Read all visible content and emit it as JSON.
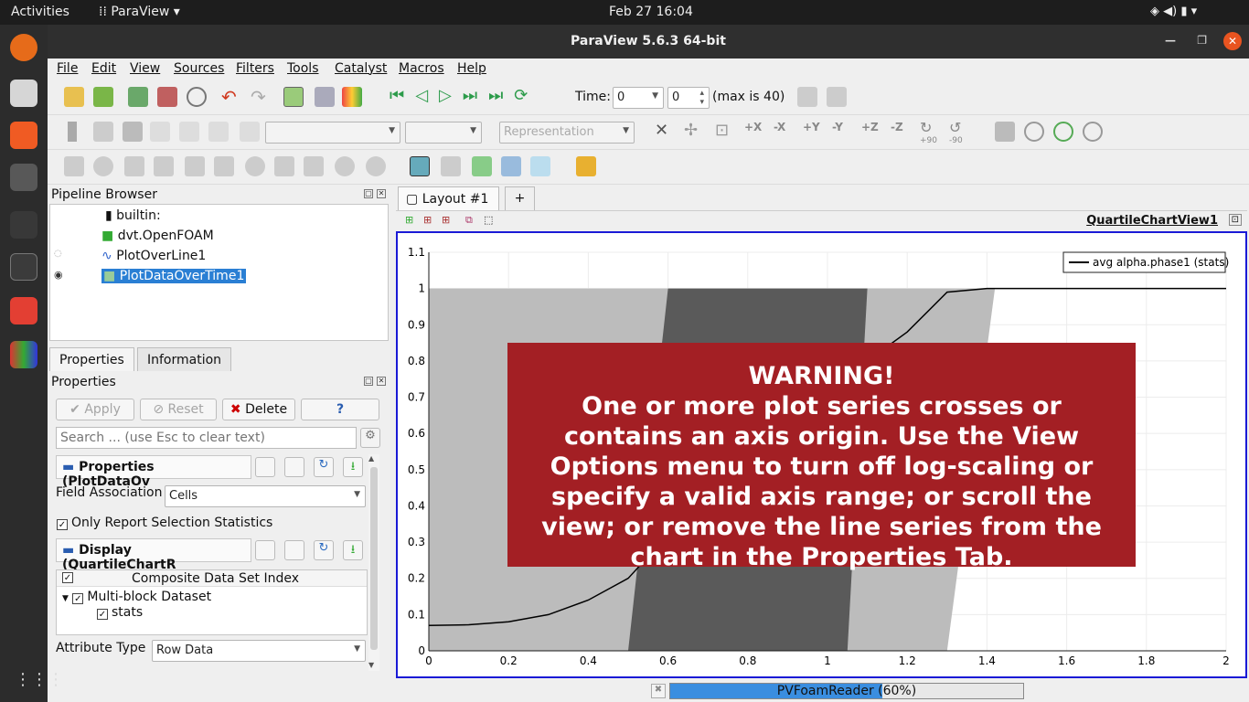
{
  "topbar": {
    "activities": "Activities",
    "app": "ParaView",
    "datetime": "Feb 27  16:04"
  },
  "window": {
    "title": "ParaView 5.6.3 64-bit"
  },
  "menu": [
    "File",
    "Edit",
    "View",
    "Sources",
    "Filters",
    "Tools",
    "Catalyst",
    "Macros",
    "Help"
  ],
  "time": {
    "label": "Time:",
    "value": "0",
    "step": "0",
    "max": "(max is 40)"
  },
  "repr_combo": {
    "placeholder": "Representation"
  },
  "view_buttons": {
    "px": "+X",
    "mx": "-X",
    "py": "+Y",
    "my": "-Y",
    "pz": "+Z",
    "mz": "-Z",
    "r90": "+90",
    "rm90": "-90"
  },
  "pipeline": {
    "title": "Pipeline Browser",
    "items": [
      "builtin:",
      "dvt.OpenFOAM",
      "PlotOverLine1",
      "PlotDataOverTime1"
    ]
  },
  "props": {
    "tabs": [
      "Properties",
      "Information"
    ],
    "title": "Properties",
    "apply": "Apply",
    "reset": "Reset",
    "delete": "Delete",
    "help": "?",
    "search_placeholder": "Search ... (use Esc to clear text)",
    "section1": "Properties (PlotDataOv",
    "field_assoc_label": "Field Association",
    "field_assoc": "Cells",
    "only_report": "Only Report Selection Statistics",
    "section2": "Display (QuartileChartR",
    "composite_header": "Composite Data Set Index",
    "multiblock": "Multi-block Dataset",
    "stats": "stats",
    "attr_type_label": "Attribute Type",
    "attr_type": "Row Data"
  },
  "layout": {
    "tab": "Layout #1",
    "plus": "+",
    "view_name": "QuartileChartView1"
  },
  "chart_data": {
    "type": "line",
    "legend": "avg alpha.phase1 (stats)",
    "legend_position": "top-right",
    "xlim": [
      0,
      2
    ],
    "ylim": [
      0,
      1.1
    ],
    "x_ticks": [
      "0",
      "0.2",
      "0.4",
      "0.6",
      "0.8",
      "1",
      "1.2",
      "1.4",
      "1.6",
      "1.8",
      "2"
    ],
    "y_ticks": [
      "0",
      "0.1",
      "0.2",
      "0.3",
      "0.4",
      "0.5",
      "0.6",
      "0.7",
      "0.8",
      "0.9",
      "1",
      "1.1"
    ],
    "series": [
      {
        "name": "avg alpha.phase1 (stats)",
        "x": [
          0,
          0.1,
          0.2,
          0.3,
          0.4,
          0.5,
          0.6,
          0.7,
          0.8,
          0.9,
          1.0,
          1.1,
          1.2,
          1.3,
          1.4,
          1.6,
          1.8,
          2.0
        ],
        "y": [
          0.07,
          0.072,
          0.08,
          0.1,
          0.14,
          0.2,
          0.32,
          0.45,
          0.58,
          0.68,
          0.74,
          0.8,
          0.88,
          0.99,
          1,
          1,
          1,
          1
        ]
      }
    ],
    "bands": [
      {
        "name": "outer",
        "color": "#bcbcbc",
        "lower_x": [
          0,
          0
        ],
        "upper_x": [
          1.3,
          1.42
        ],
        "y": [
          0,
          1
        ]
      },
      {
        "name": "inner",
        "color": "#5a5a5a",
        "lower_x": [
          0.5,
          0.6
        ],
        "upper_x": [
          1.05,
          1.1
        ],
        "y": [
          0,
          1
        ]
      }
    ]
  },
  "warning": {
    "title": "WARNING!",
    "text": "One or more plot series crosses or contains an axis origin. Use the View Options menu to turn off log-scaling or specify a valid axis range; or scroll the view; or remove the line series from the chart in the Properties Tab."
  },
  "progress": {
    "label": "PVFoamReader (60%)",
    "value": 0.6
  }
}
